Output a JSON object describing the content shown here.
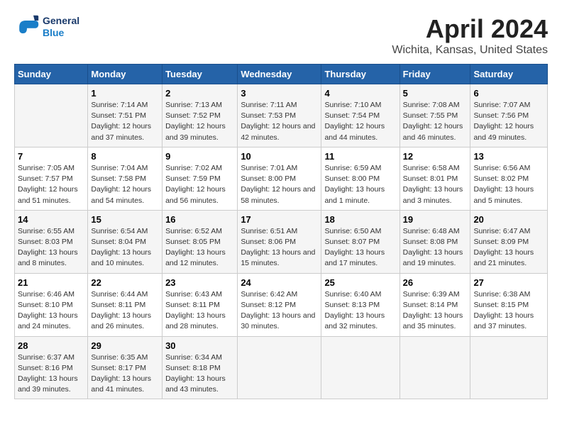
{
  "logo": {
    "line1": "General",
    "line2": "Blue"
  },
  "title": "April 2024",
  "subtitle": "Wichita, Kansas, United States",
  "days_header": [
    "Sunday",
    "Monday",
    "Tuesday",
    "Wednesday",
    "Thursday",
    "Friday",
    "Saturday"
  ],
  "weeks": [
    [
      {
        "day": "",
        "sunrise": "",
        "sunset": "",
        "daylight": ""
      },
      {
        "day": "1",
        "sunrise": "Sunrise: 7:14 AM",
        "sunset": "Sunset: 7:51 PM",
        "daylight": "Daylight: 12 hours and 37 minutes."
      },
      {
        "day": "2",
        "sunrise": "Sunrise: 7:13 AM",
        "sunset": "Sunset: 7:52 PM",
        "daylight": "Daylight: 12 hours and 39 minutes."
      },
      {
        "day": "3",
        "sunrise": "Sunrise: 7:11 AM",
        "sunset": "Sunset: 7:53 PM",
        "daylight": "Daylight: 12 hours and 42 minutes."
      },
      {
        "day": "4",
        "sunrise": "Sunrise: 7:10 AM",
        "sunset": "Sunset: 7:54 PM",
        "daylight": "Daylight: 12 hours and 44 minutes."
      },
      {
        "day": "5",
        "sunrise": "Sunrise: 7:08 AM",
        "sunset": "Sunset: 7:55 PM",
        "daylight": "Daylight: 12 hours and 46 minutes."
      },
      {
        "day": "6",
        "sunrise": "Sunrise: 7:07 AM",
        "sunset": "Sunset: 7:56 PM",
        "daylight": "Daylight: 12 hours and 49 minutes."
      }
    ],
    [
      {
        "day": "7",
        "sunrise": "Sunrise: 7:05 AM",
        "sunset": "Sunset: 7:57 PM",
        "daylight": "Daylight: 12 hours and 51 minutes."
      },
      {
        "day": "8",
        "sunrise": "Sunrise: 7:04 AM",
        "sunset": "Sunset: 7:58 PM",
        "daylight": "Daylight: 12 hours and 54 minutes."
      },
      {
        "day": "9",
        "sunrise": "Sunrise: 7:02 AM",
        "sunset": "Sunset: 7:59 PM",
        "daylight": "Daylight: 12 hours and 56 minutes."
      },
      {
        "day": "10",
        "sunrise": "Sunrise: 7:01 AM",
        "sunset": "Sunset: 8:00 PM",
        "daylight": "Daylight: 12 hours and 58 minutes."
      },
      {
        "day": "11",
        "sunrise": "Sunrise: 6:59 AM",
        "sunset": "Sunset: 8:00 PM",
        "daylight": "Daylight: 13 hours and 1 minute."
      },
      {
        "day": "12",
        "sunrise": "Sunrise: 6:58 AM",
        "sunset": "Sunset: 8:01 PM",
        "daylight": "Daylight: 13 hours and 3 minutes."
      },
      {
        "day": "13",
        "sunrise": "Sunrise: 6:56 AM",
        "sunset": "Sunset: 8:02 PM",
        "daylight": "Daylight: 13 hours and 5 minutes."
      }
    ],
    [
      {
        "day": "14",
        "sunrise": "Sunrise: 6:55 AM",
        "sunset": "Sunset: 8:03 PM",
        "daylight": "Daylight: 13 hours and 8 minutes."
      },
      {
        "day": "15",
        "sunrise": "Sunrise: 6:54 AM",
        "sunset": "Sunset: 8:04 PM",
        "daylight": "Daylight: 13 hours and 10 minutes."
      },
      {
        "day": "16",
        "sunrise": "Sunrise: 6:52 AM",
        "sunset": "Sunset: 8:05 PM",
        "daylight": "Daylight: 13 hours and 12 minutes."
      },
      {
        "day": "17",
        "sunrise": "Sunrise: 6:51 AM",
        "sunset": "Sunset: 8:06 PM",
        "daylight": "Daylight: 13 hours and 15 minutes."
      },
      {
        "day": "18",
        "sunrise": "Sunrise: 6:50 AM",
        "sunset": "Sunset: 8:07 PM",
        "daylight": "Daylight: 13 hours and 17 minutes."
      },
      {
        "day": "19",
        "sunrise": "Sunrise: 6:48 AM",
        "sunset": "Sunset: 8:08 PM",
        "daylight": "Daylight: 13 hours and 19 minutes."
      },
      {
        "day": "20",
        "sunrise": "Sunrise: 6:47 AM",
        "sunset": "Sunset: 8:09 PM",
        "daylight": "Daylight: 13 hours and 21 minutes."
      }
    ],
    [
      {
        "day": "21",
        "sunrise": "Sunrise: 6:46 AM",
        "sunset": "Sunset: 8:10 PM",
        "daylight": "Daylight: 13 hours and 24 minutes."
      },
      {
        "day": "22",
        "sunrise": "Sunrise: 6:44 AM",
        "sunset": "Sunset: 8:11 PM",
        "daylight": "Daylight: 13 hours and 26 minutes."
      },
      {
        "day": "23",
        "sunrise": "Sunrise: 6:43 AM",
        "sunset": "Sunset: 8:11 PM",
        "daylight": "Daylight: 13 hours and 28 minutes."
      },
      {
        "day": "24",
        "sunrise": "Sunrise: 6:42 AM",
        "sunset": "Sunset: 8:12 PM",
        "daylight": "Daylight: 13 hours and 30 minutes."
      },
      {
        "day": "25",
        "sunrise": "Sunrise: 6:40 AM",
        "sunset": "Sunset: 8:13 PM",
        "daylight": "Daylight: 13 hours and 32 minutes."
      },
      {
        "day": "26",
        "sunrise": "Sunrise: 6:39 AM",
        "sunset": "Sunset: 8:14 PM",
        "daylight": "Daylight: 13 hours and 35 minutes."
      },
      {
        "day": "27",
        "sunrise": "Sunrise: 6:38 AM",
        "sunset": "Sunset: 8:15 PM",
        "daylight": "Daylight: 13 hours and 37 minutes."
      }
    ],
    [
      {
        "day": "28",
        "sunrise": "Sunrise: 6:37 AM",
        "sunset": "Sunset: 8:16 PM",
        "daylight": "Daylight: 13 hours and 39 minutes."
      },
      {
        "day": "29",
        "sunrise": "Sunrise: 6:35 AM",
        "sunset": "Sunset: 8:17 PM",
        "daylight": "Daylight: 13 hours and 41 minutes."
      },
      {
        "day": "30",
        "sunrise": "Sunrise: 6:34 AM",
        "sunset": "Sunset: 8:18 PM",
        "daylight": "Daylight: 13 hours and 43 minutes."
      },
      {
        "day": "",
        "sunrise": "",
        "sunset": "",
        "daylight": ""
      },
      {
        "day": "",
        "sunrise": "",
        "sunset": "",
        "daylight": ""
      },
      {
        "day": "",
        "sunrise": "",
        "sunset": "",
        "daylight": ""
      },
      {
        "day": "",
        "sunrise": "",
        "sunset": "",
        "daylight": ""
      }
    ]
  ]
}
